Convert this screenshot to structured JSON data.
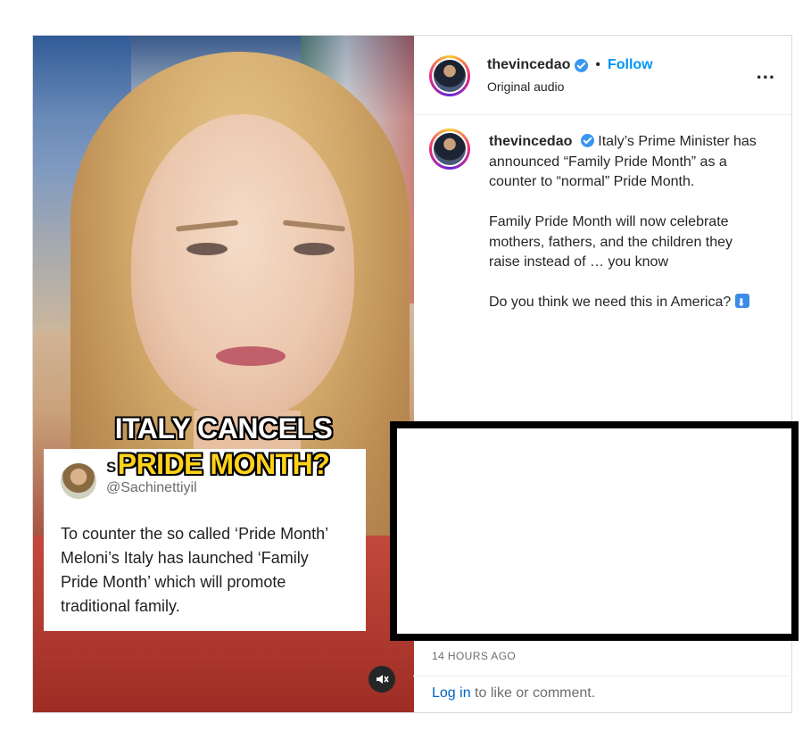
{
  "media": {
    "overlay_line1": "ITALY CANCELS",
    "overlay_line2": "PRIDE MONTH?",
    "tweet": {
      "name_visible": "S",
      "handle": "@Sachinettiyil",
      "text": "To counter the so called ‘Pride Month’ Meloni’s Italy has launched ‘Family Pride Month’ which will promote traditional family."
    },
    "mute_icon": "speaker-muted-icon"
  },
  "header": {
    "username": "thevincedao",
    "separator": "•",
    "follow_label": "Follow",
    "audio_label": "Original audio",
    "more_label": "..."
  },
  "caption": {
    "username": "thevincedao",
    "paragraph1": "Italy’s Prime Minister has announced “Family Pride Month” as a counter to “normal” Pride Month.",
    "paragraph2": "Family Pride Month will now celebrate mothers, fathers, and the children they raise instead of … you know",
    "paragraph3": "Do you think we need this in America?",
    "timestamp": "14h"
  },
  "footer": {
    "time_ago": "14 HOURS AGO",
    "login_link": "Log in",
    "login_suffix": " to like or comment."
  },
  "colors": {
    "accent": "#0095f6",
    "verified": "#3897f0",
    "overlay_yellow": "#ffd21a"
  }
}
